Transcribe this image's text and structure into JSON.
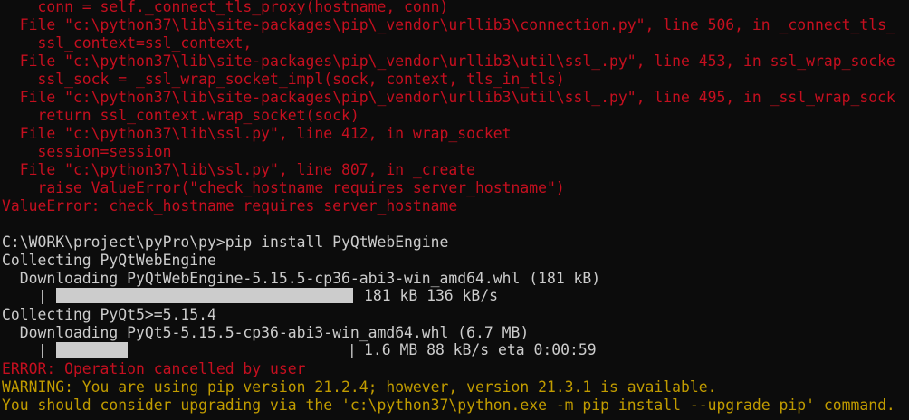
{
  "terminal": {
    "colors": {
      "background": "#0c0c0c",
      "foreground": "#cccccc",
      "error": "#c50f1f",
      "warning": "#c19c00"
    },
    "traceback": [
      "    conn = self._connect_tls_proxy(hostname, conn)",
      "  File \"c:\\python37\\lib\\site-packages\\pip\\_vendor\\urllib3\\connection.py\", line 506, in _connect_tls_",
      "    ssl_context=ssl_context,",
      "  File \"c:\\python37\\lib\\site-packages\\pip\\_vendor\\urllib3\\util\\ssl_.py\", line 453, in ssl_wrap_socke",
      "    ssl_sock = _ssl_wrap_socket_impl(sock, context, tls_in_tls)",
      "  File \"c:\\python37\\lib\\site-packages\\pip\\_vendor\\urllib3\\util\\ssl_.py\", line 495, in _ssl_wrap_sock",
      "    return ssl_context.wrap_socket(sock)",
      "  File \"c:\\python37\\lib\\ssl.py\", line 412, in wrap_socket",
      "    session=session",
      "  File \"c:\\python37\\lib\\ssl.py\", line 807, in _create",
      "    raise ValueError(\"check_hostname requires server_hostname\")",
      "ValueError: check_hostname requires server_hostname"
    ],
    "prompt_line": "C:\\WORK\\project\\pyPro\\py>pip install PyQtWebEngine",
    "collecting_1": "Collecting PyQtWebEngine",
    "downloading_1": "  Downloading PyQtWebEngine-5.15.5-cp36-abi3-win_amd64.whl (181 kB)",
    "progress_1": {
      "fraction": 1.0,
      "status": "181 kB 136 kB/s"
    },
    "collecting_2": "Collecting PyQt5>=5.15.4",
    "downloading_2": "  Downloading PyQt5-5.15.5-cp36-abi3-win_amd64.whl (6.7 MB)",
    "progress_2": {
      "fraction": 0.24,
      "status": "1.6 MB 88 kB/s eta 0:00:59"
    },
    "error_line": "ERROR: Operation cancelled by user",
    "warning_1": "WARNING: You are using pip version 21.2.4; however, version 21.3.1 is available.",
    "warning_2": "You should consider upgrading via the 'c:\\python37\\python.exe -m pip install --upgrade pip' command."
  }
}
